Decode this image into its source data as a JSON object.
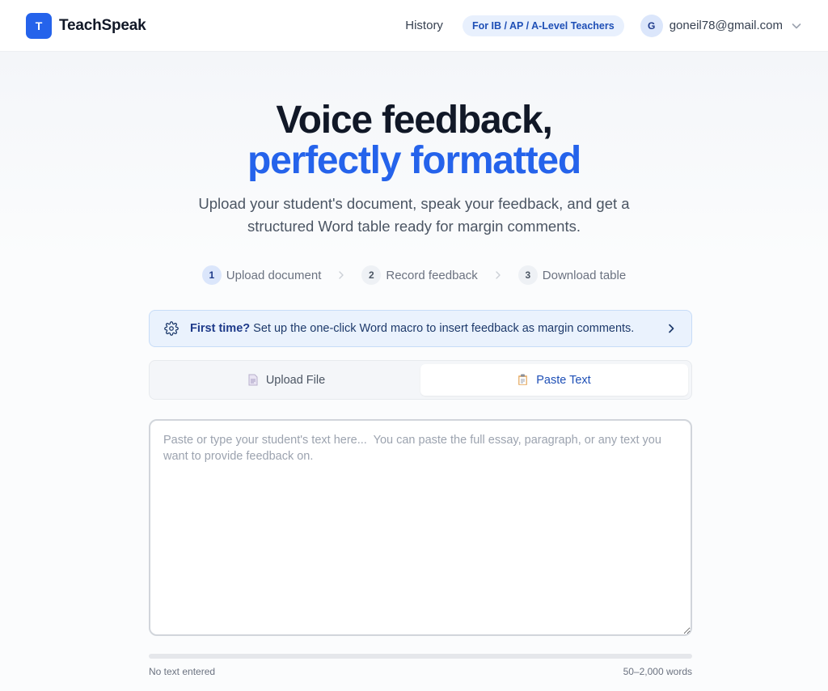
{
  "header": {
    "logo_letter": "T",
    "app_name": "TeachSpeak",
    "history_label": "History",
    "audience_badge": "For IB / AP / A-Level Teachers",
    "user_initial": "G",
    "user_email": "goneil78@gmail.com",
    "menu_icon": "chevron-down-icon"
  },
  "hero": {
    "title_line1": "Voice feedback,",
    "title_line2": "perfectly formatted",
    "subtitle": "Upload your student's document, speak your feedback, and get a structured Word table ready for margin comments."
  },
  "steps": [
    {
      "number": "1",
      "label": "Upload document",
      "active": true
    },
    {
      "number": "2",
      "label": "Record feedback",
      "active": false
    },
    {
      "number": "3",
      "label": "Download table",
      "active": false
    }
  ],
  "macro_banner": {
    "icon": "gear-icon",
    "bold_text": "First time?",
    "text": " Set up the one-click Word macro to insert feedback as margin comments.",
    "arrow_icon": "chevron-right-icon"
  },
  "tabs": [
    {
      "label": "Upload File",
      "icon": "document-icon",
      "active": false
    },
    {
      "label": "Paste Text",
      "icon": "clipboard-icon",
      "active": true
    }
  ],
  "editor": {
    "value": "",
    "placeholder": "Paste or type your student's text here...  You can paste the full essay, paragraph, or any text you want to provide feedback on."
  },
  "status": {
    "left": "No text entered",
    "right": "50–2,000 words",
    "progress": 0
  },
  "colors": {
    "accent": "#2563eb",
    "banner_bg": "#eaf2fd",
    "badge_bg": "#e8f0fd"
  }
}
